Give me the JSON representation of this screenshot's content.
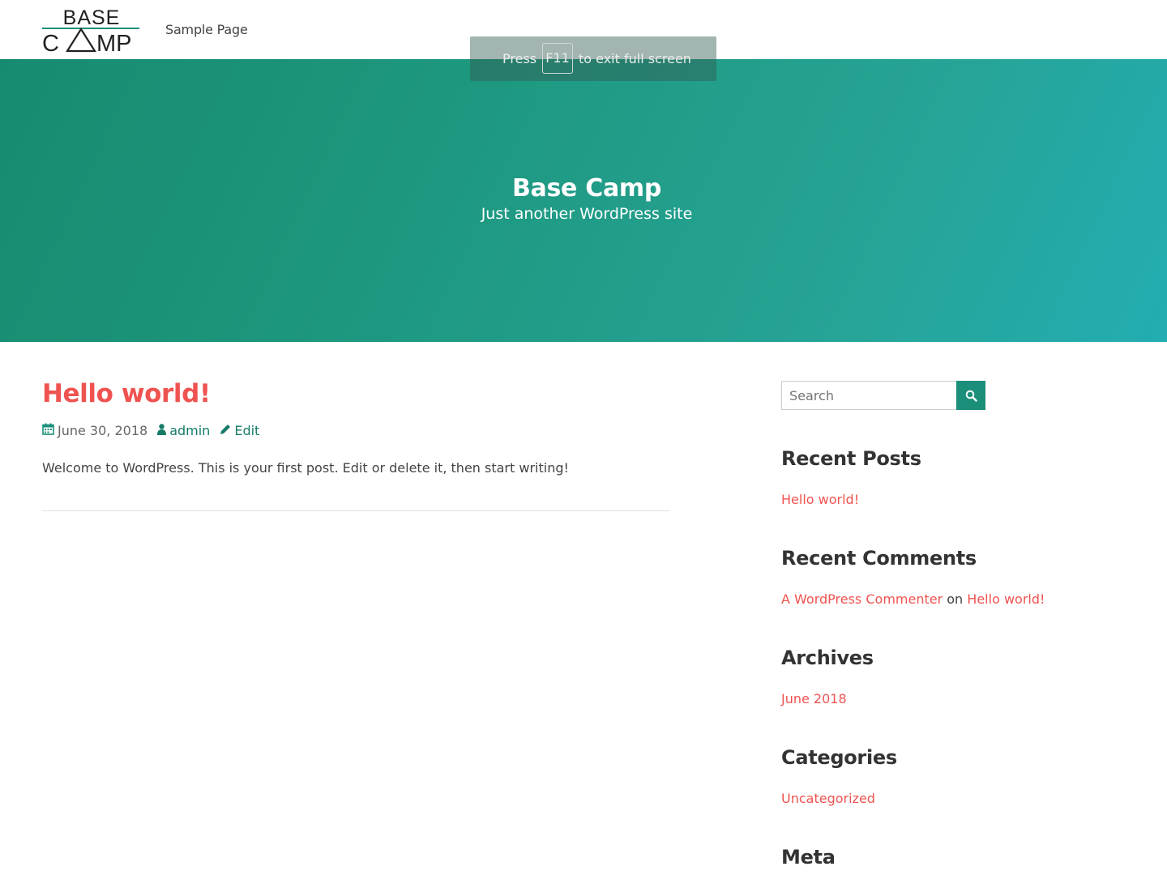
{
  "header": {
    "logo_text_top": "BASE",
    "logo_text_bottom": "CAMP",
    "nav": [
      {
        "label": "Sample Page"
      }
    ]
  },
  "hero": {
    "title": "Base Camp",
    "tagline": "Just another WordPress site"
  },
  "fullscreen_toast": {
    "press": "Press",
    "key": "F11",
    "rest": "to exit full screen"
  },
  "post": {
    "title": "Hello world!",
    "date": "June 30, 2018",
    "author": "admin",
    "edit_label": "Edit",
    "content": "Welcome to WordPress. This is your first post. Edit or delete it, then start writing!"
  },
  "sidebar": {
    "search": {
      "placeholder": "Search"
    },
    "recent_posts": {
      "title": "Recent Posts",
      "items": [
        "Hello world!"
      ]
    },
    "recent_comments": {
      "title": "Recent Comments",
      "author": "A WordPress Commenter",
      "on": "on",
      "post": "Hello world!"
    },
    "archives": {
      "title": "Archives",
      "items": [
        "June 2018"
      ]
    },
    "categories": {
      "title": "Categories",
      "items": [
        "Uncategorized"
      ]
    },
    "meta": {
      "title": "Meta"
    }
  },
  "colors": {
    "accent": "#ef5350",
    "brand": "#1c8f7a",
    "hero_start": "#178b6f",
    "hero_end": "#23adb2"
  },
  "icons": {
    "date": "calendar-icon",
    "author": "user-icon",
    "edit": "pencil-icon",
    "search": "search-icon"
  }
}
